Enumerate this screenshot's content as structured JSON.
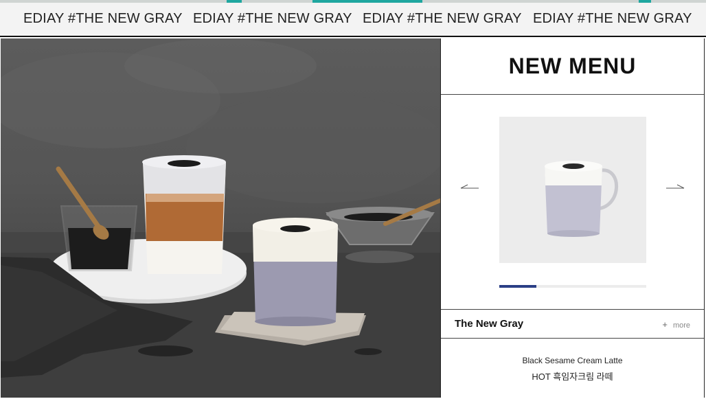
{
  "marquee": {
    "items": [
      "EDIAY #THE NEW GRAY",
      "EDIAY #THE NEW GRAY",
      "EDIAY #THE NEW GRAY",
      "EDIAY #THE NEW GRAY"
    ]
  },
  "colors": {
    "accent_teal": "#1fa7a0",
    "progress_fill": "#2b3f86",
    "border": "#222222"
  },
  "panel": {
    "title": "NEW MENU",
    "slider": {
      "prev_icon": "arrow-left-icon",
      "next_icon": "arrow-right-icon",
      "progress": 0.25
    },
    "item": {
      "name": "The New Gray",
      "more_label": "more",
      "more_icon": "plus-icon"
    },
    "description": {
      "english": "Black Sesame Cream Latte",
      "korean": "HOT 흑임자크림 라떼"
    }
  }
}
